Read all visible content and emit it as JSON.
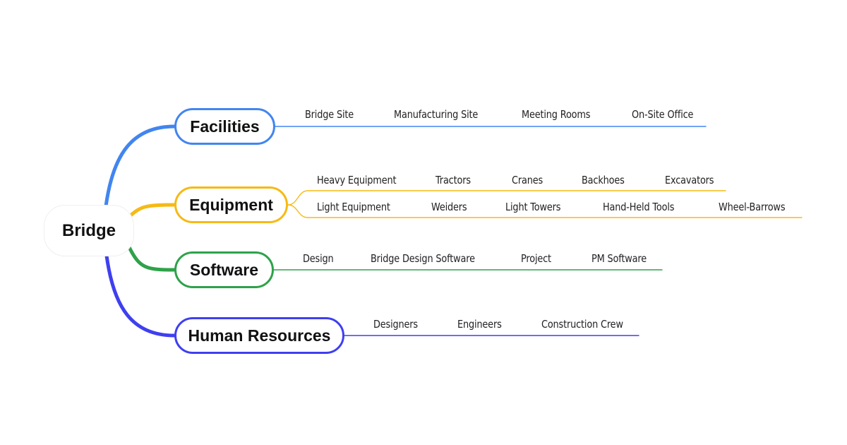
{
  "root": {
    "label": "Bridge"
  },
  "colors": {
    "facilities": "#4285f0",
    "equipment": "#f5ba14",
    "software": "#2fa24a",
    "human_resources": "#3f3ff0"
  },
  "branches": [
    {
      "label": "Facilities",
      "rows": [
        [
          "Bridge Site",
          "Manufacturing Site",
          "Meeting Rooms",
          "On-Site Office"
        ]
      ]
    },
    {
      "label": "Equipment",
      "rows": [
        [
          "Heavy Equipment",
          "Tractors",
          "Cranes",
          "Backhoes",
          "Excavators"
        ],
        [
          "Light Equipment",
          "Weiders",
          "Light Towers",
          "Hand-Held Tools",
          "Wheel-Barrows"
        ]
      ]
    },
    {
      "label": "Software",
      "rows": [
        [
          "Design",
          "Bridge Design Software",
          "Project",
          "PM Software"
        ]
      ]
    },
    {
      "label": "Human Resources",
      "rows": [
        [
          "Designers",
          "Engineers",
          "Construction Crew"
        ]
      ]
    }
  ]
}
